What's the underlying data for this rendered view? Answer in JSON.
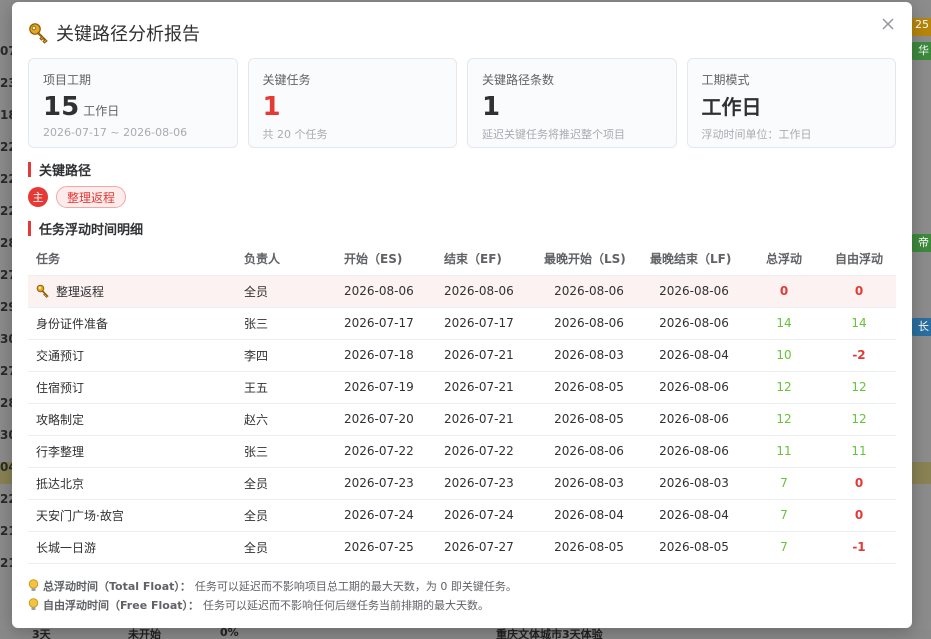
{
  "background": {
    "left_numbers": [
      "07",
      "23",
      "18",
      "22",
      "22",
      "22",
      "28",
      "27",
      "29",
      "30",
      "27",
      "28",
      "30",
      "04",
      "22",
      "21",
      "21"
    ],
    "right_tags": [
      {
        "text": "25",
        "color": "#b8860b"
      },
      {
        "text": "华",
        "color": "#3d8a3d"
      },
      {
        "text": "帝",
        "color": "#3d8a3d"
      },
      {
        "text": "长",
        "color": "#2a6fa0"
      }
    ],
    "bottom_texts": [
      "3天",
      "未开始",
      "0%",
      "重庆文体城市3天体验"
    ]
  },
  "modal": {
    "title": "关键路径分析报告",
    "title_icon": "key-icon",
    "close_icon": "close-icon"
  },
  "cards": [
    {
      "label": "项目工期",
      "value": "15",
      "unit": "工作日",
      "sub": "2026-07-17 ~ 2026-08-06"
    },
    {
      "label": "关键任务",
      "value": "1",
      "unit": "",
      "sub": "共 20 个任务"
    },
    {
      "label": "关键路径条数",
      "value": "1",
      "unit": "",
      "sub": "延迟关键任务将推迟整个项目"
    },
    {
      "label": "工期模式",
      "value": "工作日",
      "unit": "",
      "sub": "浮动时间单位：工作日"
    }
  ],
  "critical_path": {
    "section_title": "关键路径",
    "badge": "主",
    "chip": "整理返程"
  },
  "float_table": {
    "section_title": "任务浮动时间明细",
    "headers": [
      "任务",
      "负责人",
      "开始（ES)",
      "结束（EF)",
      "最晚开始（LS)",
      "最晚结束（LF)",
      "总浮动",
      "自由浮动"
    ],
    "rows": [
      {
        "task": "整理返程",
        "owner": "全员",
        "es": "2026-08-06",
        "ef": "2026-08-06",
        "ls": "2026-08-06",
        "lf": "2026-08-06",
        "tf": "0",
        "ff": "0",
        "critical": true
      },
      {
        "task": "身份证件准备",
        "owner": "张三",
        "es": "2026-07-17",
        "ef": "2026-07-17",
        "ls": "2026-08-06",
        "lf": "2026-08-06",
        "tf": "14",
        "ff": "14",
        "critical": false
      },
      {
        "task": "交通预订",
        "owner": "李四",
        "es": "2026-07-18",
        "ef": "2026-07-21",
        "ls": "2026-08-03",
        "lf": "2026-08-04",
        "tf": "10",
        "ff": "-2",
        "critical": false
      },
      {
        "task": "住宿预订",
        "owner": "王五",
        "es": "2026-07-19",
        "ef": "2026-07-21",
        "ls": "2026-08-05",
        "lf": "2026-08-06",
        "tf": "12",
        "ff": "12",
        "critical": false
      },
      {
        "task": "攻略制定",
        "owner": "赵六",
        "es": "2026-07-20",
        "ef": "2026-07-21",
        "ls": "2026-08-05",
        "lf": "2026-08-06",
        "tf": "12",
        "ff": "12",
        "critical": false
      },
      {
        "task": "行李整理",
        "owner": "张三",
        "es": "2026-07-22",
        "ef": "2026-07-22",
        "ls": "2026-08-06",
        "lf": "2026-08-06",
        "tf": "11",
        "ff": "11",
        "critical": false
      },
      {
        "task": "抵达北京",
        "owner": "全员",
        "es": "2026-07-23",
        "ef": "2026-07-23",
        "ls": "2026-08-03",
        "lf": "2026-08-03",
        "tf": "7",
        "ff": "0",
        "critical": false
      },
      {
        "task": "天安门广场·故宫",
        "owner": "全员",
        "es": "2026-07-24",
        "ef": "2026-07-24",
        "ls": "2026-08-04",
        "lf": "2026-08-04",
        "tf": "7",
        "ff": "0",
        "critical": false
      },
      {
        "task": "长城一日游",
        "owner": "全员",
        "es": "2026-07-25",
        "ef": "2026-07-27",
        "ls": "2026-08-05",
        "lf": "2026-08-05",
        "tf": "7",
        "ff": "-1",
        "critical": false
      }
    ]
  },
  "notes": [
    {
      "term": "总浮动时间（Total Float）：",
      "text": "任务可以延迟而不影响项目总工期的最大天数，为 0 即关键任务。"
    },
    {
      "term": "自由浮动时间（Free Float）：",
      "text": "任务可以延迟而不影响任何后继任务当前排期的最大天数。"
    }
  ],
  "colors": {
    "critical": "#e53935",
    "positive_float": "#67c23a"
  }
}
